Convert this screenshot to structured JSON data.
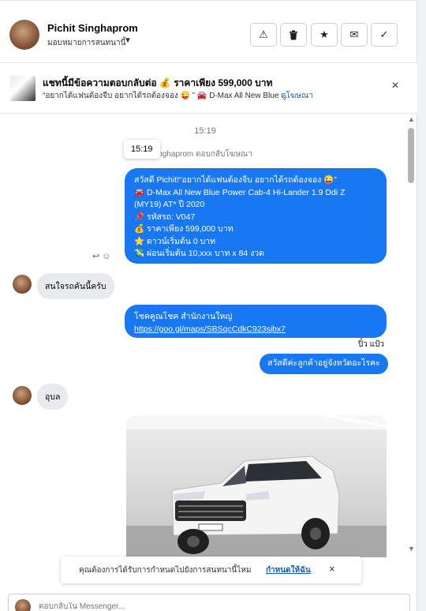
{
  "header": {
    "name": "Pichit Singhaprom",
    "subtitle": "มอบหมายการสนทนานี้",
    "actions": [
      {
        "icon": "alert-icon",
        "glyph": "⚠"
      },
      {
        "icon": "trash-icon",
        "glyph": "🗑"
      },
      {
        "icon": "star-icon",
        "glyph": "★"
      },
      {
        "icon": "mail-icon",
        "glyph": "✉"
      },
      {
        "icon": "check-icon",
        "glyph": "✓"
      }
    ]
  },
  "ad": {
    "title": "แชทนี้มีข้อความตอบกลับต่อ 💰 ราคาเพียง 599,000 บาท",
    "description": "“อยากได้แฟนต้องจีบ อยากได้รถต้องจอง 😜 ” 🚘 D-Max All New Blue ...",
    "link_label": "ดูโฆษณา",
    "close_glyph": "×"
  },
  "conversation": {
    "timestamp": "15:19",
    "tooltip": "15:19",
    "reply_note": "inghaprom ตอบกลับโฆษณา",
    "ad_message_lines": [
      "สวัสดี Pichit!“อยากได้แฟนต้องจีบ อยากได้รถต้องจอง 😜”",
      "🚘 D-Max All New Blue Power Cab-4 Hi-Lander 1.9 Ddi Z",
      "(MY19) AT* ปี 2020",
      "📌 รหัสรถ: V047",
      "💰 ราคาเพียง 599,000 บาท",
      "⭐ ดาวน์เริ่มต้น 0 บาท",
      "💸 ผ่อนเริ่มต้น 10,xxx บาท x 84 งวด"
    ],
    "action_glyphs": "↩ ☺",
    "customer_msg_1": "สนใจรถคันนี้ครับ",
    "location_line_1": "โชคคูณโชค สำนักงานใหญ่",
    "location_link": "https://goo.gl/maps/SBSqcCdkC923sjbx7",
    "seen_by": "ปิ๋ว แป้ว",
    "agent_question": "สวัสดีค่ะลูกค้าอยู่จังหวัดอะไรคะ",
    "customer_msg_2": "อุบล"
  },
  "notification": {
    "text": "คุณต้องการได้รับการกำหนดไปยังการสนทนานี้ไหม",
    "link": "กำหนดให้ฉัน",
    "close_glyph": "×"
  },
  "composer": {
    "placeholder": "ตอบกลับใน Messenger..."
  },
  "colors": {
    "accent": "#1877f2",
    "bubble_grey": "#e9eaed"
  }
}
